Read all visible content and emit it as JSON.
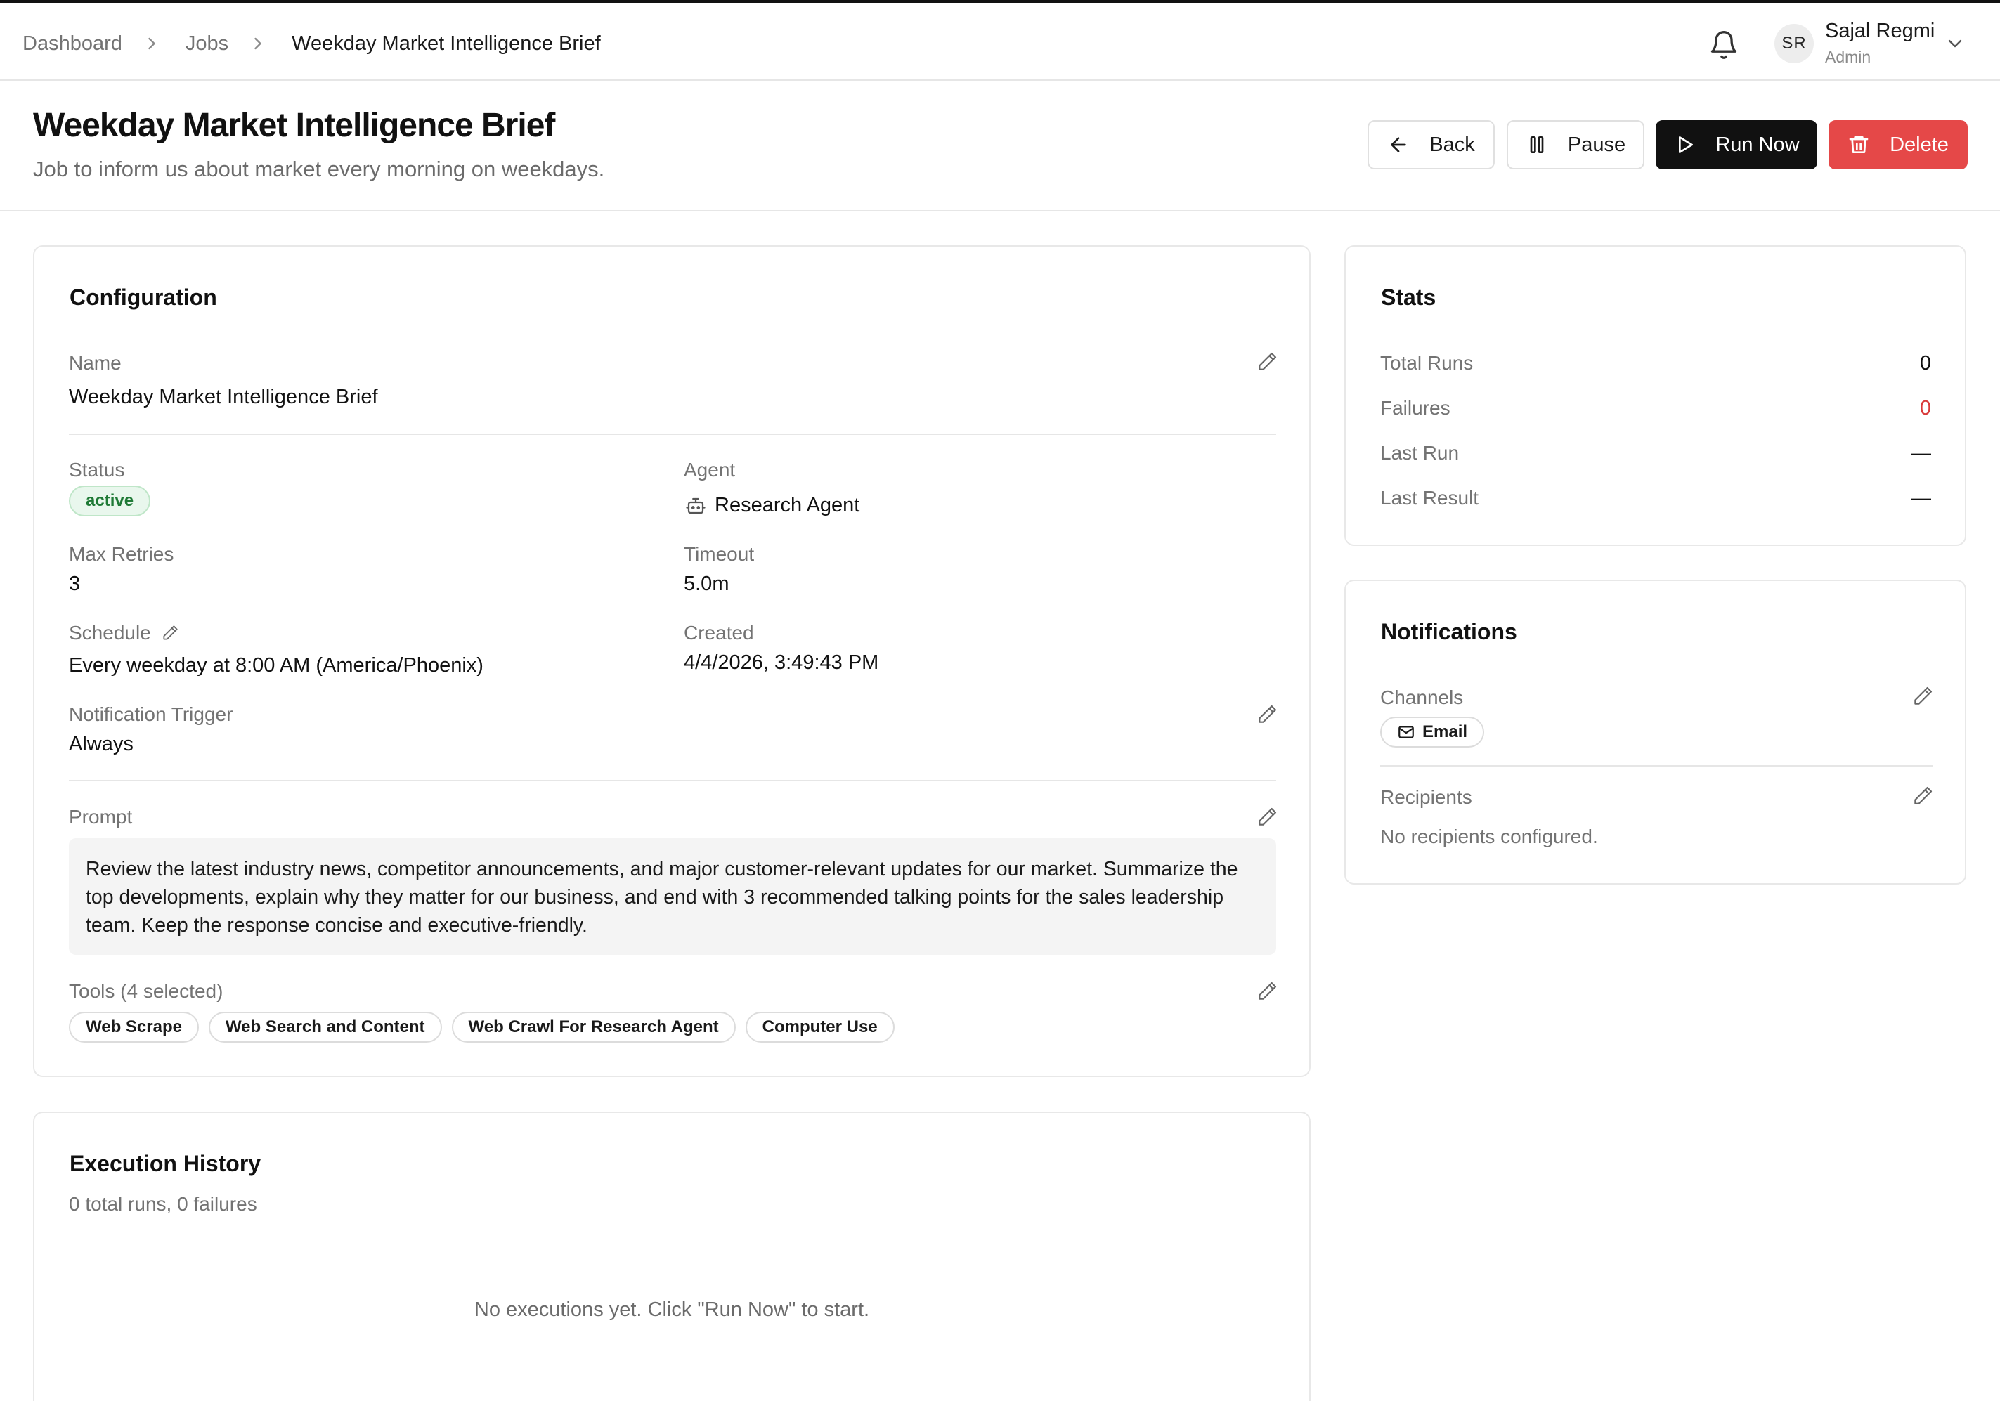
{
  "breadcrumb": {
    "items": [
      "Dashboard",
      "Jobs"
    ],
    "current": "Weekday Market Intelligence Brief"
  },
  "user": {
    "initials": "SR",
    "name": "Sajal Regmi",
    "role": "Admin"
  },
  "header": {
    "title": "Weekday Market Intelligence Brief",
    "subtitle": "Job to inform us about market every morning on weekdays.",
    "buttons": {
      "back": "Back",
      "pause": "Pause",
      "run": "Run Now",
      "delete": "Delete"
    }
  },
  "configuration": {
    "title": "Configuration",
    "name_label": "Name",
    "name_value": "Weekday Market Intelligence Brief",
    "status_label": "Status",
    "status_value": "active",
    "agent_label": "Agent",
    "agent_value": "Research Agent",
    "max_retries_label": "Max Retries",
    "max_retries_value": "3",
    "timeout_label": "Timeout",
    "timeout_value": "5.0m",
    "schedule_label": "Schedule",
    "schedule_value": "Every weekday at 8:00 AM (America/Phoenix)",
    "created_label": "Created",
    "created_value": "4/4/2026, 3:49:43 PM",
    "notification_trigger_label": "Notification Trigger",
    "notification_trigger_value": "Always",
    "prompt_label": "Prompt",
    "prompt_value": "Review the latest industry news, competitor announcements, and major customer-relevant updates for our market. Summarize the top developments, explain why they matter for our business, and end with 3 recommended talking points for the sales leadership team. Keep the response concise and executive-friendly.",
    "tools_label": "Tools (4 selected)",
    "tools": [
      "Web Scrape",
      "Web Search and Content",
      "Web Crawl For Research Agent",
      "Computer Use"
    ]
  },
  "history": {
    "title": "Execution History",
    "summary": "0 total runs, 0 failures",
    "empty": "No executions yet. Click \"Run Now\" to start."
  },
  "stats": {
    "title": "Stats",
    "rows": [
      {
        "label": "Total Runs",
        "value": "0"
      },
      {
        "label": "Failures",
        "value": "0"
      },
      {
        "label": "Last Run",
        "value": "—"
      },
      {
        "label": "Last Result",
        "value": "—"
      }
    ]
  },
  "notifications": {
    "title": "Notifications",
    "channels_label": "Channels",
    "channel": "Email",
    "recipients_label": "Recipients",
    "recipients_value": "No recipients configured."
  },
  "colors": {
    "primary": "#111111",
    "danger": "#e54848",
    "failure_text": "#d93b3b",
    "status_active_bg": "#e9f7ed",
    "status_active_text": "#1f7a36"
  }
}
